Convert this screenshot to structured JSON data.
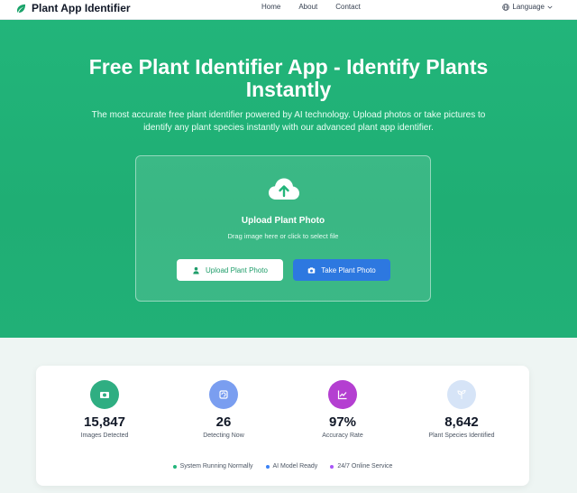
{
  "nav": {
    "brand": "Plant App Identifier",
    "links": [
      "Home",
      "About",
      "Contact"
    ],
    "language": "Language"
  },
  "hero": {
    "title": "Free Plant Identifier App - Identify Plants Instantly",
    "subtitle": "The most accurate free plant identifier powered by AI technology. Upload photos or take pictures to identify any plant species instantly with our advanced plant app identifier.",
    "upload": {
      "title": "Upload Plant Photo",
      "hint": "Drag image here or click to select file",
      "upload_button": "Upload Plant Photo",
      "camera_button": "Take Plant Photo"
    }
  },
  "stats": [
    {
      "value": "15,847",
      "label": "Images Detected",
      "icon": "camera-icon",
      "color": "#2fae82"
    },
    {
      "value": "26",
      "label": "Detecting Now",
      "icon": "refresh-icon",
      "color": "#7a9ef0"
    },
    {
      "value": "97%",
      "label": "Accuracy Rate",
      "icon": "chart-icon",
      "color": "#b43fd1"
    },
    {
      "value": "8,642",
      "label": "Plant Species Identified",
      "icon": "plant-icon",
      "color": "#d6e4f7"
    }
  ],
  "status": [
    {
      "label": "System Running Normally",
      "color": "#22b57a"
    },
    {
      "label": "AI Model Ready",
      "color": "#3b82f6"
    },
    {
      "label": "24/7 Online Service",
      "color": "#a855f7"
    }
  ],
  "colors": {
    "brand_green": "#22b57a",
    "primary_blue": "#2d78e0"
  }
}
